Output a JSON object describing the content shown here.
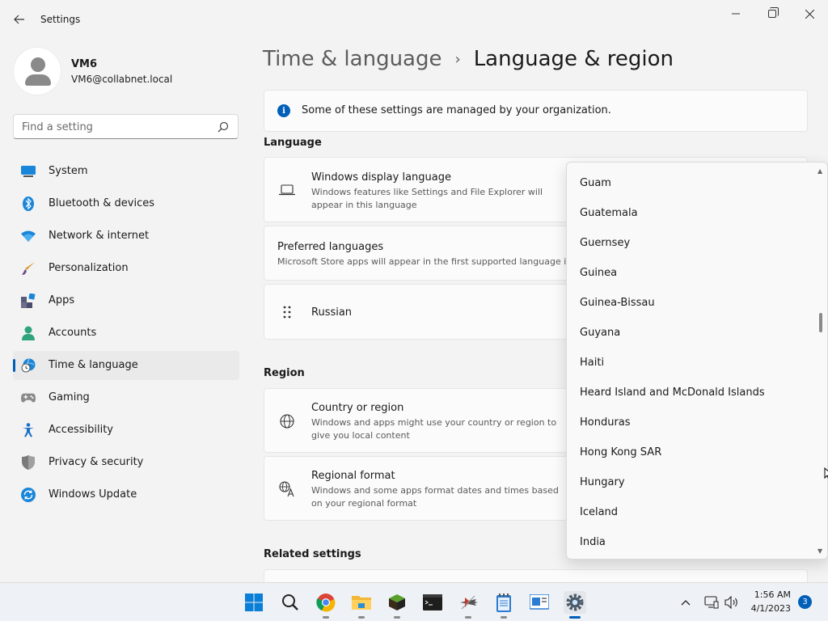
{
  "window": {
    "title": "Settings",
    "back_icon": "arrow-left-icon"
  },
  "profile": {
    "name": "VM6",
    "email": "VM6@collabnet.local"
  },
  "search": {
    "placeholder": "Find a setting"
  },
  "sidebar": {
    "items": [
      {
        "label": "System",
        "icon": "system-icon",
        "active": false
      },
      {
        "label": "Bluetooth & devices",
        "icon": "bluetooth-icon",
        "active": false
      },
      {
        "label": "Network & internet",
        "icon": "wifi-icon",
        "active": false
      },
      {
        "label": "Personalization",
        "icon": "brush-icon",
        "active": false
      },
      {
        "label": "Apps",
        "icon": "apps-icon",
        "active": false
      },
      {
        "label": "Accounts",
        "icon": "person-icon",
        "active": false
      },
      {
        "label": "Time & language",
        "icon": "globe-clock-icon",
        "active": true
      },
      {
        "label": "Gaming",
        "icon": "gamepad-icon",
        "active": false
      },
      {
        "label": "Accessibility",
        "icon": "accessibility-icon",
        "active": false
      },
      {
        "label": "Privacy & security",
        "icon": "shield-icon",
        "active": false
      },
      {
        "label": "Windows Update",
        "icon": "update-icon",
        "active": false
      }
    ]
  },
  "breadcrumb": {
    "parent": "Time & language",
    "separator": "›",
    "current": "Language & region"
  },
  "info_banner": {
    "icon_glyph": "i",
    "text": "Some of these settings are managed by your organization."
  },
  "language_section": {
    "title": "Language",
    "display_language": {
      "title": "Windows display language",
      "description": "Windows features like Settings and File Explorer will appear in this language"
    },
    "preferred_languages": {
      "title": "Preferred languages",
      "description": "Microsoft Store apps will appear in the first supported language in this list"
    },
    "language_entry": {
      "name": "Russian"
    }
  },
  "region_section": {
    "title": "Region",
    "country_or_region": {
      "title": "Country or region",
      "description": "Windows and apps might use your country or region to give you local content"
    },
    "regional_format": {
      "title": "Regional format",
      "description": "Windows and some apps format dates and times based on your regional format"
    }
  },
  "related_settings": {
    "title": "Related settings"
  },
  "country_dropdown": {
    "options": [
      "Guam",
      "Guatemala",
      "Guernsey",
      "Guinea",
      "Guinea-Bissau",
      "Guyana",
      "Haiti",
      "Heard Island and McDonald Islands",
      "Honduras",
      "Hong Kong SAR",
      "Hungary",
      "Iceland",
      "India"
    ]
  },
  "taskbar": {
    "apps": [
      "windows-start-icon",
      "search-icon",
      "chrome-icon",
      "file-explorer-icon",
      "minecraft-icon",
      "terminal-icon",
      "plane-app-icon",
      "notepad-icon",
      "remote-desktop-icon",
      "settings-gear-icon"
    ],
    "time": "1:56 AM",
    "date": "4/1/2023",
    "notification_count": "3"
  },
  "colors": {
    "accent": "#005fb8",
    "background": "#f3f3f3",
    "card": "#fbfbfb"
  }
}
